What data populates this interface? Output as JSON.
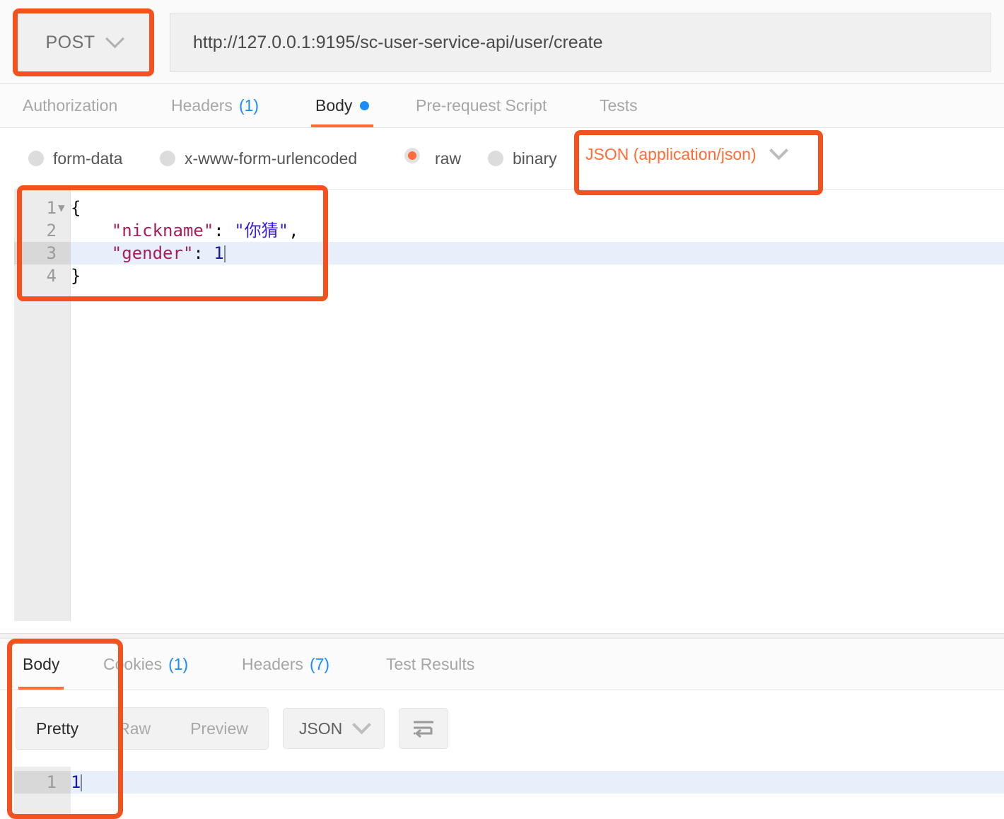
{
  "request": {
    "method": "POST",
    "url": "http://127.0.0.1:9195/sc-user-service-api/user/create",
    "tabs": [
      {
        "label": "Authorization",
        "count": "",
        "active": false,
        "dot": false
      },
      {
        "label": "Headers",
        "count": "(1)",
        "active": false,
        "dot": false
      },
      {
        "label": "Body",
        "count": "",
        "active": true,
        "dot": true
      },
      {
        "label": "Pre-request Script",
        "count": "",
        "active": false,
        "dot": false
      },
      {
        "label": "Tests",
        "count": "",
        "active": false,
        "dot": false
      }
    ],
    "body_types": [
      {
        "label": "form-data",
        "selected": false
      },
      {
        "label": "x-www-form-urlencoded",
        "selected": false
      },
      {
        "label": "raw",
        "selected": true
      },
      {
        "label": "binary",
        "selected": false
      }
    ],
    "content_type": "JSON (application/json)",
    "editor": {
      "lines": [
        {
          "number": "1",
          "foldable": true,
          "highlighted": false,
          "tokens": [
            {
              "t": "punc",
              "v": "{"
            }
          ]
        },
        {
          "number": "2",
          "foldable": false,
          "highlighted": false,
          "tokens": [
            {
              "t": "punc",
              "v": "    "
            },
            {
              "t": "key",
              "v": "\"nickname\""
            },
            {
              "t": "punc",
              "v": ": "
            },
            {
              "t": "str",
              "v": "\"你猜\""
            },
            {
              "t": "punc",
              "v": ","
            }
          ]
        },
        {
          "number": "3",
          "foldable": false,
          "highlighted": true,
          "caret": true,
          "tokens": [
            {
              "t": "punc",
              "v": "    "
            },
            {
              "t": "key",
              "v": "\"gender\""
            },
            {
              "t": "punc",
              "v": ": "
            },
            {
              "t": "num",
              "v": "1"
            }
          ]
        },
        {
          "number": "4",
          "foldable": false,
          "highlighted": false,
          "tokens": [
            {
              "t": "punc",
              "v": "}"
            }
          ]
        }
      ]
    }
  },
  "response": {
    "tabs": [
      {
        "label": "Body",
        "count": "",
        "active": true
      },
      {
        "label": "Cookies",
        "count": "(1)",
        "active": false
      },
      {
        "label": "Headers",
        "count": "(7)",
        "active": false
      },
      {
        "label": "Test Results",
        "count": "",
        "active": false
      }
    ],
    "formats": [
      {
        "label": "Pretty",
        "active": true
      },
      {
        "label": "Raw",
        "active": false
      },
      {
        "label": "Preview",
        "active": false
      }
    ],
    "language": "JSON",
    "wrap_icon": "word-wrap-icon",
    "editor": {
      "lines": [
        {
          "number": "1",
          "highlighted": true,
          "caret": true,
          "tokens": [
            {
              "t": "num",
              "v": "1"
            }
          ]
        }
      ]
    }
  },
  "icons": {
    "method_chevron": "chevron-down-icon",
    "content_type_chevron": "chevron-down-icon",
    "language_chevron": "chevron-down-icon"
  },
  "colors": {
    "accent": "#ff6c37",
    "annotation": "#f4511e",
    "link": "#1a8cff",
    "json_key": "#a71d5d",
    "json_string": "#3a1fe0",
    "json_number": "#1a1aa8",
    "line_highlight": "#e7f0fa"
  }
}
